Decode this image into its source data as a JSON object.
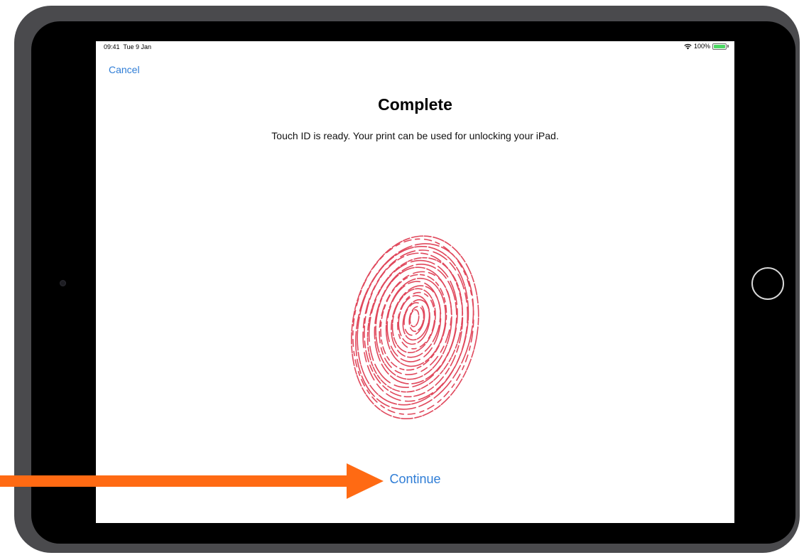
{
  "status_bar": {
    "time": "09:41",
    "date": "Tue 9 Jan",
    "battery_percent": "100%",
    "battery_level": 1.0,
    "icons": [
      "wifi-icon",
      "battery-icon"
    ]
  },
  "nav": {
    "cancel_label": "Cancel"
  },
  "main": {
    "title": "Complete",
    "subtitle": "Touch ID is ready. Your print can be used for unlocking your iPad.",
    "continue_label": "Continue",
    "illustration": "fingerprint-icon"
  },
  "colors": {
    "accent": "#2f7dd6",
    "fingerprint": "#e0485c",
    "annotation_arrow": "#ff6a13",
    "bezel": "#4a4a4d",
    "battery_fill": "#4cd964"
  }
}
